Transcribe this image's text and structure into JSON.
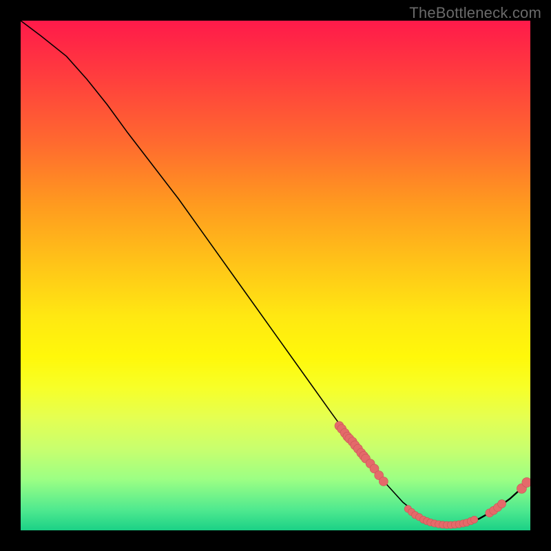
{
  "watermark": "TheBottleneck.com",
  "colors": {
    "bg": "#000000",
    "dot": "#e46a6a"
  },
  "chart_data": {
    "type": "line",
    "title": "",
    "xlabel": "",
    "ylabel": "",
    "xlim": [
      0,
      100
    ],
    "ylim": [
      0,
      100
    ],
    "curve": [
      {
        "x": 0,
        "y": 100
      },
      {
        "x": 4,
        "y": 97
      },
      {
        "x": 9,
        "y": 93
      },
      {
        "x": 13,
        "y": 88.5
      },
      {
        "x": 17,
        "y": 83.5
      },
      {
        "x": 21,
        "y": 78
      },
      {
        "x": 26,
        "y": 71.5
      },
      {
        "x": 31,
        "y": 65
      },
      {
        "x": 36,
        "y": 58
      },
      {
        "x": 41,
        "y": 51
      },
      {
        "x": 46,
        "y": 44
      },
      {
        "x": 51,
        "y": 37
      },
      {
        "x": 56,
        "y": 30
      },
      {
        "x": 61,
        "y": 23
      },
      {
        "x": 65,
        "y": 17.5
      },
      {
        "x": 69,
        "y": 12.5
      },
      {
        "x": 72,
        "y": 8.8
      },
      {
        "x": 75,
        "y": 5.5
      },
      {
        "x": 78,
        "y": 3.1
      },
      {
        "x": 81,
        "y": 1.6
      },
      {
        "x": 84,
        "y": 1.1
      },
      {
        "x": 87,
        "y": 1.3
      },
      {
        "x": 90,
        "y": 2.3
      },
      {
        "x": 93,
        "y": 4.0
      },
      {
        "x": 96,
        "y": 6.2
      },
      {
        "x": 99,
        "y": 8.9
      },
      {
        "x": 100,
        "y": 10.0
      }
    ],
    "cluster_a": [
      {
        "x": 62.5,
        "y": 20.5
      },
      {
        "x": 63.0,
        "y": 19.9
      },
      {
        "x": 63.6,
        "y": 19.1
      },
      {
        "x": 64.1,
        "y": 18.4
      },
      {
        "x": 64.5,
        "y": 18.0
      },
      {
        "x": 65.1,
        "y": 17.4
      },
      {
        "x": 65.6,
        "y": 16.7
      },
      {
        "x": 66.2,
        "y": 16.0
      },
      {
        "x": 66.8,
        "y": 15.2
      },
      {
        "x": 67.3,
        "y": 14.6
      },
      {
        "x": 67.7,
        "y": 14.1
      },
      {
        "x": 68.6,
        "y": 13.1
      },
      {
        "x": 69.4,
        "y": 12.1
      },
      {
        "x": 70.3,
        "y": 10.8
      },
      {
        "x": 71.2,
        "y": 9.6
      }
    ],
    "cluster_b": [
      {
        "x": 76.0,
        "y": 4.2
      },
      {
        "x": 76.7,
        "y": 3.6
      },
      {
        "x": 77.4,
        "y": 3.0
      },
      {
        "x": 78.2,
        "y": 2.6
      },
      {
        "x": 79.0,
        "y": 2.1
      },
      {
        "x": 79.7,
        "y": 1.8
      },
      {
        "x": 80.4,
        "y": 1.55
      },
      {
        "x": 81.2,
        "y": 1.35
      },
      {
        "x": 82.0,
        "y": 1.2
      },
      {
        "x": 82.8,
        "y": 1.1
      },
      {
        "x": 83.6,
        "y": 1.05
      },
      {
        "x": 84.4,
        "y": 1.05
      },
      {
        "x": 85.2,
        "y": 1.1
      },
      {
        "x": 86.0,
        "y": 1.2
      },
      {
        "x": 86.8,
        "y": 1.35
      },
      {
        "x": 87.5,
        "y": 1.5
      },
      {
        "x": 88.3,
        "y": 1.8
      },
      {
        "x": 89.0,
        "y": 2.1
      }
    ],
    "cluster_c": [
      {
        "x": 92.0,
        "y": 3.4
      },
      {
        "x": 92.8,
        "y": 3.9
      },
      {
        "x": 93.6,
        "y": 4.5
      },
      {
        "x": 94.4,
        "y": 5.2
      }
    ],
    "cluster_d": [
      {
        "x": 98.3,
        "y": 8.2
      },
      {
        "x": 99.3,
        "y": 9.4
      }
    ]
  }
}
